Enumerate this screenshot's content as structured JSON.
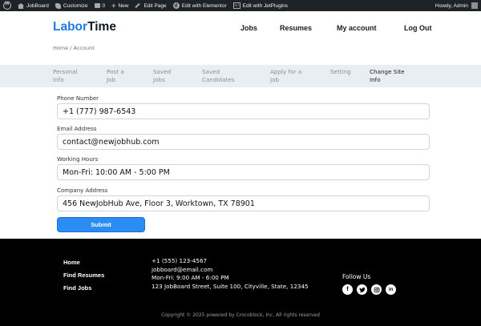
{
  "adminbar": {
    "site_name": "JobBoard",
    "customize": "Customize",
    "comments_count": "0",
    "new": "New",
    "edit_page": "Edit Page",
    "edit_elementor": "Edit with Elementor",
    "edit_jetplugins": "Edit with JetPlugins",
    "jet_icon_text": "JET",
    "howdy": "Howdy, Admin"
  },
  "header": {
    "logo_part1": "Labor",
    "logo_part2": "Time",
    "nav": [
      "Jobs",
      "Resumes",
      "My account",
      "Log Out"
    ],
    "breadcrumb": "Home / Account"
  },
  "tabs": [
    {
      "label": "Personal\nInfo",
      "active": false
    },
    {
      "label": "Post a\nJob",
      "active": false
    },
    {
      "label": "Saved\nJobs",
      "active": false
    },
    {
      "label": "Saved\nCandidates",
      "active": false
    },
    {
      "label": "Apply for a\nJob",
      "active": false
    },
    {
      "label": "Setting",
      "active": false
    },
    {
      "label": "Change Site\nInfo",
      "active": true
    }
  ],
  "form": {
    "fields": [
      {
        "label": "Phone Number",
        "value": "+1 (777) 987-6543"
      },
      {
        "label": "Email Address",
        "value": "contact@newjobhub.com"
      },
      {
        "label": "Working Hours",
        "value": "Mon-Fri: 10:00 AM - 5:00 PM"
      },
      {
        "label": "Company Address",
        "value": "456 NewJobHub Ave, Floor 3, Worktown, TX 78901"
      }
    ],
    "submit_label": "Submit"
  },
  "footer": {
    "links": [
      "Home",
      "Find Resumes",
      "Find Jobs"
    ],
    "contact": [
      "+1 (555) 123-4567",
      "jobboard@email.com",
      "Mon-Fri: 9:00 AM - 6:00 PM",
      "123 JobBoard Street, Suite 100, Cityville, State, 12345"
    ],
    "follow_label": "Follow Us",
    "socials": [
      "facebook-icon",
      "twitter-icon",
      "instagram-icon",
      "linkedin-icon"
    ],
    "social_glyphs": {
      "facebook": "f",
      "linkedin": "in"
    },
    "copyright": "Copyright © 2025 powered by Crocoblock, Inc. All rights reserved"
  },
  "colors": {
    "brand_blue": "#1e7be5",
    "button_blue": "#2b8cf4",
    "admin_bar": "#1d2327",
    "tab_bar": "#e8eef4",
    "footer_bg": "#000000"
  }
}
